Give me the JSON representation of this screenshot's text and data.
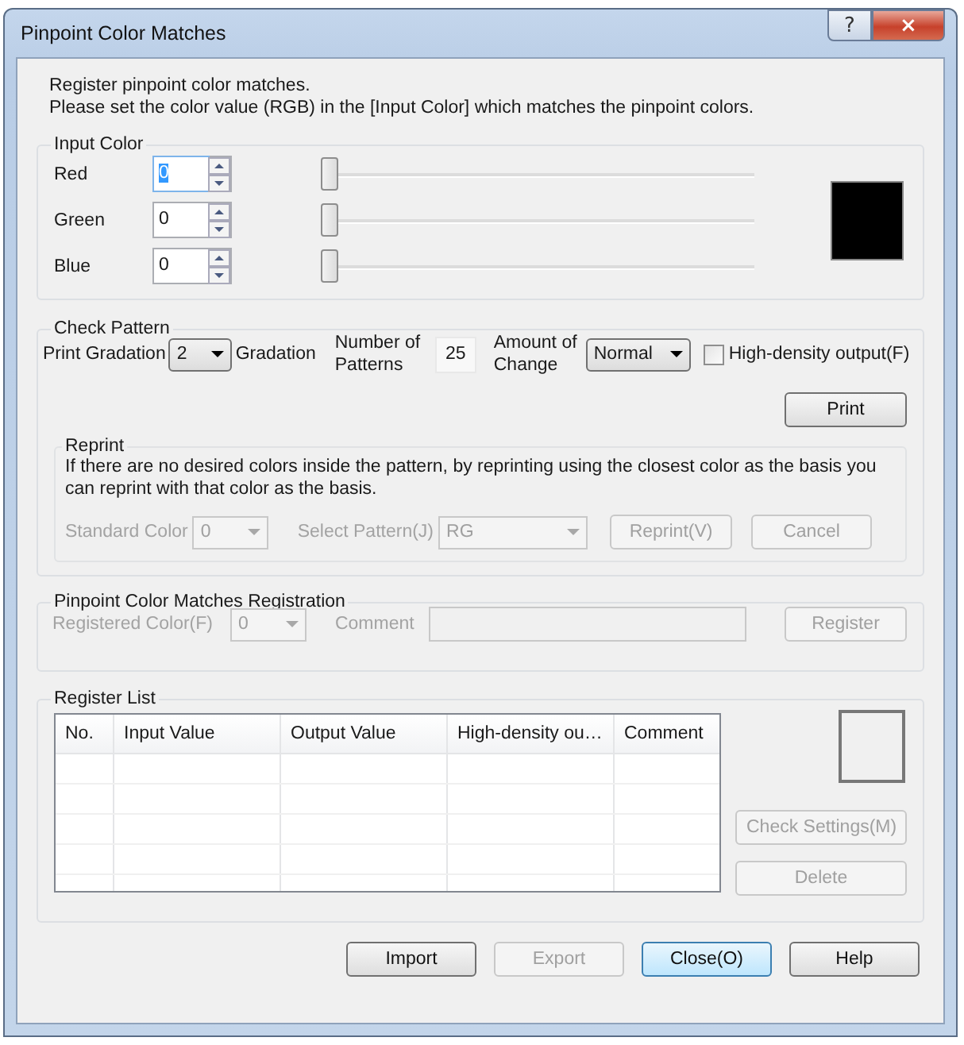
{
  "window": {
    "title": "Pinpoint Color Matches",
    "help_glyph": "?",
    "close_glyph": "×"
  },
  "intro": [
    "Register pinpoint color matches.",
    "Please set the color value (RGB) in the [Input Color] which matches the pinpoint colors."
  ],
  "input_color": {
    "legend": "Input Color",
    "channels": [
      {
        "label": "Red",
        "value": "0",
        "level": 0,
        "focused": true
      },
      {
        "label": "Green",
        "value": "0",
        "level": 0,
        "focused": false
      },
      {
        "label": "Blue",
        "value": "0",
        "level": 0,
        "focused": false
      }
    ]
  },
  "check_pattern": {
    "legend": "Check Pattern",
    "print_gradation": {
      "label": "Print Gradation",
      "value": "2",
      "suffix": "Gradation"
    },
    "patterns": {
      "label": "Number of Patterns",
      "value": "25"
    },
    "amount": {
      "label": "Amount of Change",
      "value": "Normal"
    },
    "high_density": {
      "label": "High-density output(F)",
      "checked": false
    },
    "print_button": {
      "label": "Print",
      "disabled": false
    },
    "reprint": {
      "legend": "Reprint",
      "text": "If there are no desired colors inside the pattern, by reprinting using the closest color as the basis you can reprint with that color as the basis.",
      "standard_color": {
        "label": "Standard Color",
        "value": "0",
        "disabled": true
      },
      "select_pattern": {
        "label": "Select Pattern(J)",
        "value": "RG",
        "disabled": true
      },
      "buttons": [
        {
          "label": "Reprint(V)",
          "disabled": true
        },
        {
          "label": "Cancel",
          "disabled": true
        }
      ]
    }
  },
  "registration": {
    "legend": "Pinpoint Color Matches Registration",
    "registered_color": {
      "label": "Registered Color(F)",
      "value": "0",
      "disabled": true
    },
    "comment": {
      "label": "Comment",
      "disabled": true
    },
    "register_button": {
      "label": "Register",
      "disabled": true
    }
  },
  "register_list": {
    "legend": "Register List",
    "columns": [
      "No.",
      "Input Value",
      "Output Value",
      "High-density ou…",
      "Comment"
    ],
    "buttons": [
      {
        "label": "Check Settings(M)",
        "disabled": true
      },
      {
        "label": "Delete",
        "disabled": true
      }
    ]
  },
  "footer_buttons": [
    {
      "label": "Import",
      "disabled": false,
      "default": false
    },
    {
      "label": "Export",
      "disabled": true,
      "default": false
    },
    {
      "label": "Close(O)",
      "disabled": false,
      "default": true
    },
    {
      "label": "Help",
      "disabled": false,
      "default": false
    }
  ]
}
